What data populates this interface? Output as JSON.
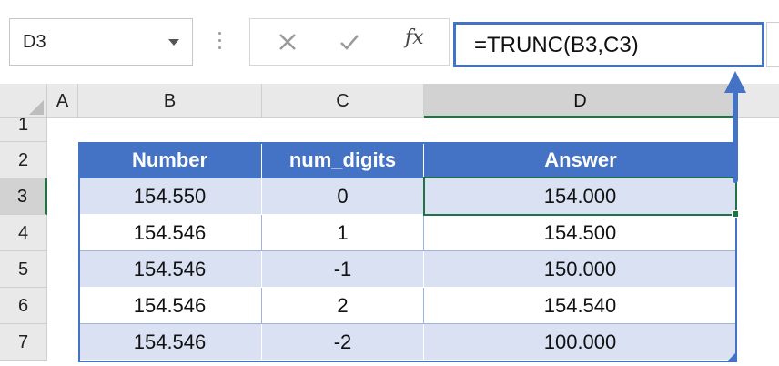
{
  "name_box": {
    "value": "D3"
  },
  "formula_bar": {
    "formula": "=TRUNC(B3,C3)"
  },
  "formula_controls": {
    "fx_label": "fx"
  },
  "columns": [
    "A",
    "B",
    "C",
    "D"
  ],
  "rows": [
    "1",
    "2",
    "3",
    "4",
    "5",
    "6",
    "7"
  ],
  "table": {
    "headers": [
      "Number",
      "num_digits",
      "Answer"
    ],
    "rows": [
      {
        "number": "154.550",
        "digits": "0",
        "answer": "154.000"
      },
      {
        "number": "154.546",
        "digits": "1",
        "answer": "154.500"
      },
      {
        "number": "154.546",
        "digits": "-1",
        "answer": "150.000"
      },
      {
        "number": "154.546",
        "digits": "2",
        "answer": "154.540"
      },
      {
        "number": "154.546",
        "digits": "-2",
        "answer": "100.000"
      }
    ]
  },
  "colors": {
    "header_blue": "#4472c4",
    "band_blue": "#d9e1f2",
    "excel_green": "#217346"
  }
}
